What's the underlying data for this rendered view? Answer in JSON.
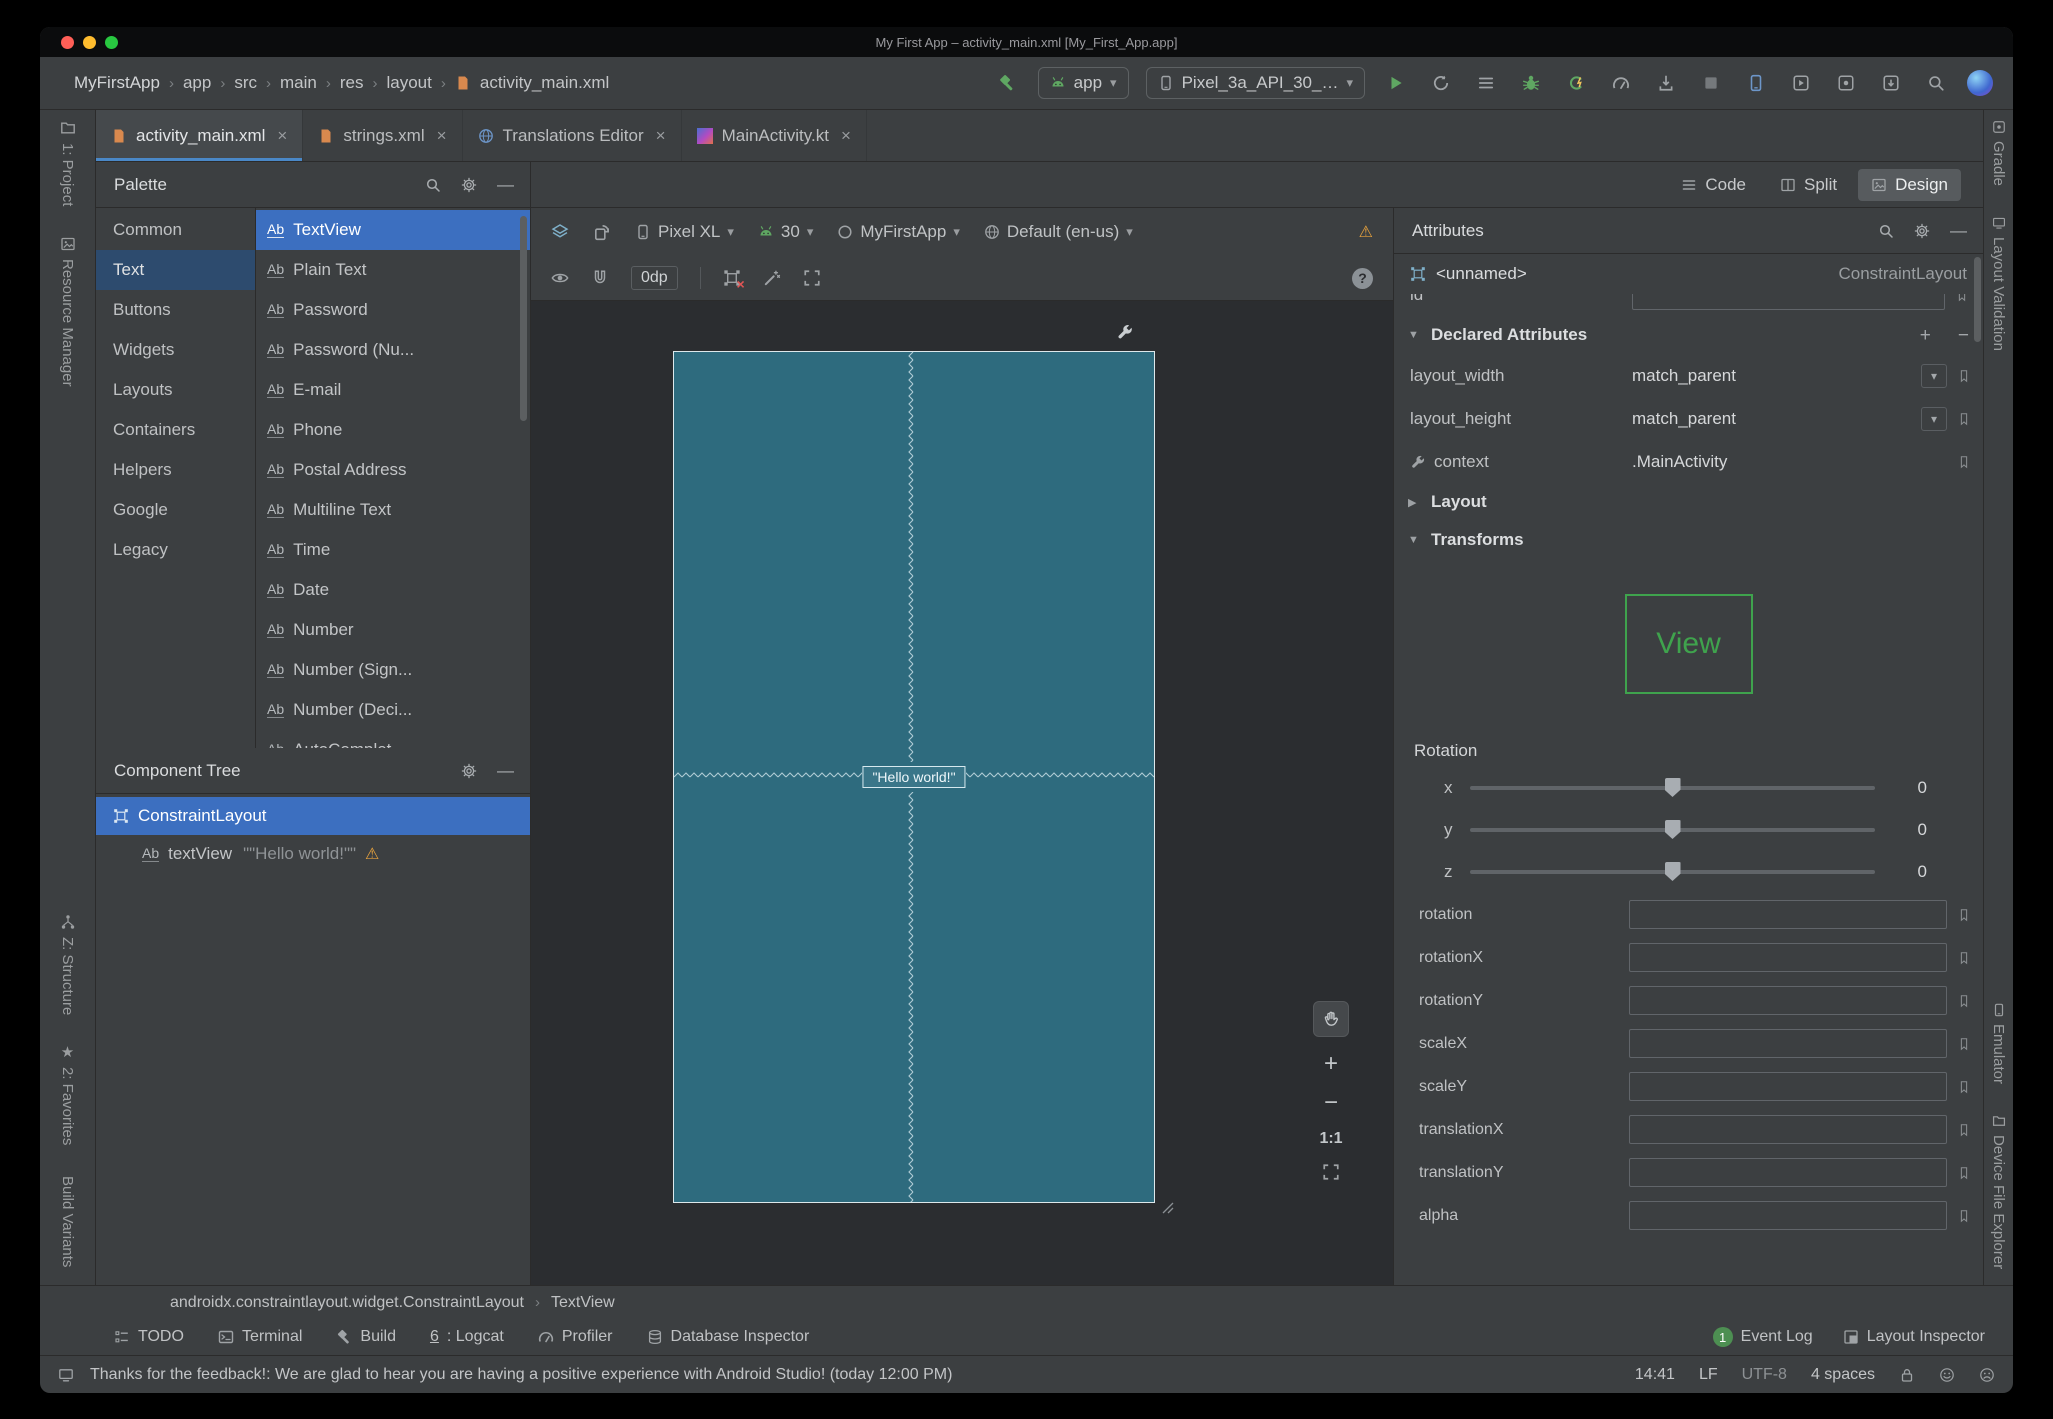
{
  "icons": {
    "sep": "›",
    "chevron": "▾",
    "minimize": "—",
    "close": "×",
    "warning": "⚠",
    "star": "★",
    "plus": "+",
    "minus": "−",
    "sec_open": "▼",
    "sec_closed": "▶",
    "question": "?",
    "ab": "Ab",
    "zoom_in": "+",
    "zoom_out": "−",
    "resize": "⟋"
  },
  "window": {
    "title": "My First App – activity_main.xml [My_First_App.app]"
  },
  "toolbar": {
    "breadcrumbs": [
      "MyFirstApp",
      "app",
      "src",
      "main",
      "res",
      "layout"
    ],
    "breadcrumb_file": "activity_main.xml",
    "run_config": "app",
    "device": "Pixel_3a_API_30_…"
  },
  "tabs": [
    {
      "label": "activity_main.xml"
    },
    {
      "label": "strings.xml"
    },
    {
      "label": "Translations Editor"
    },
    {
      "label": "MainActivity.kt"
    }
  ],
  "view_modes": {
    "code": "Code",
    "split": "Split",
    "design": "Design"
  },
  "left_stripe": {
    "project": "1: Project",
    "resource_manager": "Resource Manager",
    "structure": "Z: Structure",
    "favorites": "2: Favorites",
    "build_variants": "Build Variants"
  },
  "right_stripe": {
    "gradle": "Gradle",
    "layout_validation": "Layout Validation",
    "emulator": "Emulator",
    "device_file_explorer": "Device File Explorer"
  },
  "palette": {
    "title": "Palette",
    "categories": [
      "Common",
      "Text",
      "Buttons",
      "Widgets",
      "Layouts",
      "Containers",
      "Helpers",
      "Google",
      "Legacy"
    ],
    "items": [
      "TextView",
      "Plain Text",
      "Password",
      "Password (Nu...",
      "E-mail",
      "Phone",
      "Postal Address",
      "Multiline Text",
      "Time",
      "Date",
      "Number",
      "Number (Sign...",
      "Number (Deci...",
      "AutoComplet"
    ]
  },
  "component_tree": {
    "title": "Component Tree",
    "root": "ConstraintLayout",
    "child": "textView",
    "child_detail": "\"\"Hello world!\"\""
  },
  "design_toolbar": {
    "device": "Pixel XL",
    "api": "30",
    "theme": "MyFirstApp",
    "locale": "Default (en-us)",
    "margin": "0dp"
  },
  "canvas": {
    "hello": "\"Hello world!\"",
    "zoom": "1:1"
  },
  "attributes": {
    "title": "Attributes",
    "component": "<unnamed>",
    "component_type": "ConstraintLayout",
    "id_label": "id",
    "declared_title": "Declared Attributes",
    "rows": [
      {
        "name": "layout_width",
        "value": "match_parent"
      },
      {
        "name": "layout_height",
        "value": "match_parent"
      },
      {
        "name": "context",
        "value": ".MainActivity"
      }
    ],
    "layout_section": "Layout",
    "transforms_section": "Transforms",
    "view_preview": "View",
    "rotation_title": "Rotation",
    "sliders": [
      {
        "axis": "x",
        "value": "0"
      },
      {
        "axis": "y",
        "value": "0"
      },
      {
        "axis": "z",
        "value": "0"
      }
    ],
    "fields": [
      "rotation",
      "rotationX",
      "rotationY",
      "scaleX",
      "scaleY",
      "translationX",
      "translationY",
      "alpha"
    ]
  },
  "bottom_breadcrumb": {
    "root": "androidx.constraintlayout.widget.ConstraintLayout",
    "child": "TextView"
  },
  "bottom_bar": {
    "todo": "TODO",
    "terminal": "Terminal",
    "build": "Build",
    "logcat_num": "6",
    "logcat_rest": ": Logcat",
    "profiler": "Profiler",
    "db_inspector": "Database Inspector",
    "event_count": "1",
    "event_log": "Event Log",
    "layout_inspector": "Layout Inspector"
  },
  "status_bar": {
    "message": "Thanks for the feedback!: We are glad to hear you are having a positive experience with Android Studio! (today 12:00 PM)",
    "time": "14:41",
    "line_sep": "LF",
    "encoding": "UTF-8",
    "indent": "4 spaces"
  }
}
